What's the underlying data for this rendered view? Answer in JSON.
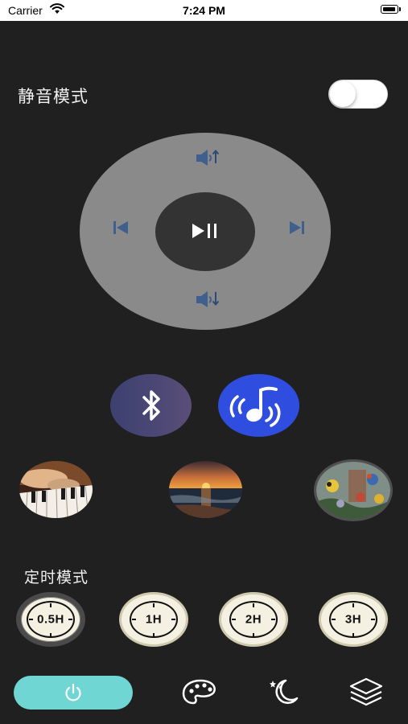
{
  "status_bar": {
    "carrier": "Carrier",
    "time": "7:24 PM",
    "battery_level": 0.85
  },
  "mute": {
    "label": "静音模式",
    "enabled": false
  },
  "remote": {
    "volume_up_icon": "volume-up-icon",
    "volume_down_icon": "volume-down-icon",
    "previous_icon": "skip-previous-icon",
    "next_icon": "skip-next-icon",
    "play_pause_icon": "play-pause-icon"
  },
  "connect": {
    "bluetooth_icon": "bluetooth-icon",
    "music_icon": "music-note-waves-icon",
    "bluetooth_color": "#464474",
    "music_color": "#2f4ee0"
  },
  "scenes": [
    "piano",
    "sunset-sea",
    "birds"
  ],
  "timer": {
    "label": "定时模式",
    "options": [
      "0.5H",
      "1H",
      "2H",
      "3H"
    ],
    "selected": "0.5H"
  },
  "tab_bar": {
    "power_icon": "power-icon",
    "accent": "#6fd6d3",
    "items": [
      "palette-icon",
      "moon-stars-icon",
      "layers-icon"
    ]
  }
}
